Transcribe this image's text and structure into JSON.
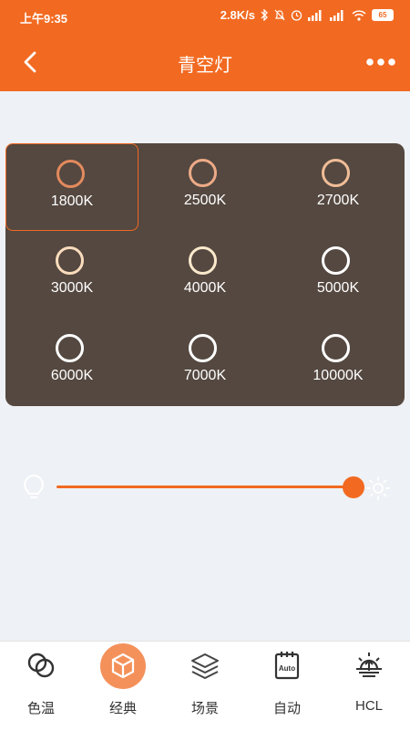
{
  "status_bar": {
    "time": "上午9:35",
    "network_speed": "2.8K/s",
    "battery": "65"
  },
  "header": {
    "title": "青空灯"
  },
  "colors": {
    "accent": "#f26a21",
    "panel_bg": "#544840",
    "page_bg": "#eef1f5"
  },
  "temperature_presets": [
    {
      "label": "1800K",
      "ring_color": "#e38a5d",
      "selected": true
    },
    {
      "label": "2500K",
      "ring_color": "#edaa87",
      "selected": false
    },
    {
      "label": "2700K",
      "ring_color": "#f0bd97",
      "selected": false
    },
    {
      "label": "3000K",
      "ring_color": "#f9dcbc",
      "selected": false
    },
    {
      "label": "4000K",
      "ring_color": "#fbe9cc",
      "selected": false
    },
    {
      "label": "5000K",
      "ring_color": "#ffffff",
      "selected": false
    },
    {
      "label": "6000K",
      "ring_color": "#ffffff",
      "selected": false
    },
    {
      "label": "7000K",
      "ring_color": "#ffffff",
      "selected": false
    },
    {
      "label": "10000K",
      "ring_color": "#ffffff",
      "selected": false
    }
  ],
  "brightness": {
    "value_fraction": 1.0
  },
  "tabs": [
    {
      "label": "色温",
      "icon": "color-temperature-icon",
      "active": false
    },
    {
      "label": "经典",
      "icon": "cube-icon",
      "active": true
    },
    {
      "label": "场景",
      "icon": "layers-icon",
      "active": false
    },
    {
      "label": "自动",
      "icon": "auto-calendar-icon",
      "active": false
    },
    {
      "label": "HCL",
      "icon": "sunrise-icon",
      "active": false
    }
  ]
}
